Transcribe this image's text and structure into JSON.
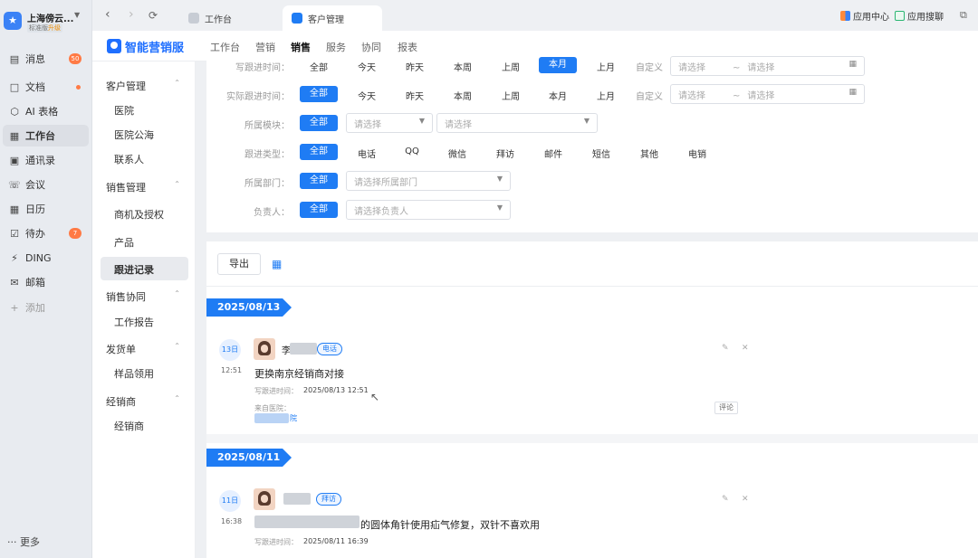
{
  "org": {
    "name": "上海傍云...",
    "edition": "标准版",
    "upgrade": "升级"
  },
  "nav": [
    {
      "label": "消息",
      "icon": "message-icon",
      "badge": "50"
    },
    {
      "label": "文档",
      "icon": "document-icon",
      "dot": true
    },
    {
      "label": "AI 表格",
      "icon": "ai-table-icon"
    },
    {
      "label": "工作台",
      "icon": "workbench-icon",
      "active": true
    },
    {
      "label": "通讯录",
      "icon": "contacts-icon"
    },
    {
      "label": "会议",
      "icon": "meeting-icon"
    },
    {
      "label": "日历",
      "icon": "calendar-icon"
    },
    {
      "label": "待办",
      "icon": "todo-icon",
      "badge": "7"
    },
    {
      "label": "DING",
      "icon": "ding-icon"
    },
    {
      "label": "邮箱",
      "icon": "mail-icon"
    },
    {
      "label": "添加",
      "icon": "add-icon",
      "muted": true
    }
  ],
  "nav_more": "··· 更多",
  "tabs": {
    "workbench": "工作台",
    "customer": "客户管理"
  },
  "topbar_right": {
    "app_center": "应用中心",
    "app_search": "应用搜聊"
  },
  "brand": "智能营销服",
  "main_tabs": [
    "工作台",
    "营销",
    "销售",
    "服务",
    "协同",
    "报表"
  ],
  "sidebar": {
    "groups": [
      {
        "label": "客户管理",
        "items": [
          "医院",
          "医院公海",
          "联系人"
        ]
      },
      {
        "label": "销售管理",
        "items": [
          "商机及授权",
          "产品",
          "跟进记录"
        ]
      },
      {
        "label": "销售协同",
        "items": [
          "工作报告"
        ]
      },
      {
        "label": "发货单",
        "items": [
          "样品领用"
        ]
      },
      {
        "label": "经销商",
        "items": [
          "经销商"
        ]
      }
    ],
    "active_item": "跟进记录"
  },
  "filters": {
    "write_time": {
      "label": "写跟进时间：",
      "options": [
        "全部",
        "今天",
        "昨天",
        "本周",
        "上周",
        "本月",
        "上月",
        "自定义"
      ],
      "selected": "本月"
    },
    "actual_time": {
      "label": "实际跟进时间：",
      "options": [
        "全部",
        "今天",
        "昨天",
        "本周",
        "上周",
        "本月",
        "上月",
        "自定义"
      ],
      "selected": "全部"
    },
    "date_placeholder": "请选择",
    "date_sep": "~",
    "module": {
      "label": "所属模块：",
      "all": "全部",
      "placeholder1": "请选择",
      "placeholder2": "请选择"
    },
    "type": {
      "label": "跟进类型：",
      "options": [
        "全部",
        "电话",
        "QQ",
        "微信",
        "拜访",
        "邮件",
        "短信",
        "其他",
        "电销"
      ],
      "selected": "全部"
    },
    "dept": {
      "label": "所属部门：",
      "all": "全部",
      "placeholder": "请选择所属部门"
    },
    "owner": {
      "label": "负责人：",
      "all": "全部",
      "placeholder": "请选择负责人"
    }
  },
  "list": {
    "export": "导出",
    "groups": [
      {
        "date": "2025/08/13",
        "record": {
          "day": "13日",
          "time": "12:51",
          "name": "李",
          "type": "电话",
          "content": "更换南京经销商对接",
          "write_label": "写跟进时间：",
          "write_time": "2025/08/13 12:51",
          "source_label": "来自医院：",
          "source_suffix": "院",
          "comment": "评论"
        }
      },
      {
        "date": "2025/08/11",
        "record": {
          "day": "11日",
          "time": "16:38",
          "type": "拜访",
          "content": "的圆体角针使用疝气修复，双针不喜欢用",
          "write_label": "写跟进时间：",
          "write_time": "2025/08/11 16:39"
        }
      }
    ]
  },
  "colors": {
    "accent": "#1f7cf4",
    "badge": "#ff7a45"
  }
}
